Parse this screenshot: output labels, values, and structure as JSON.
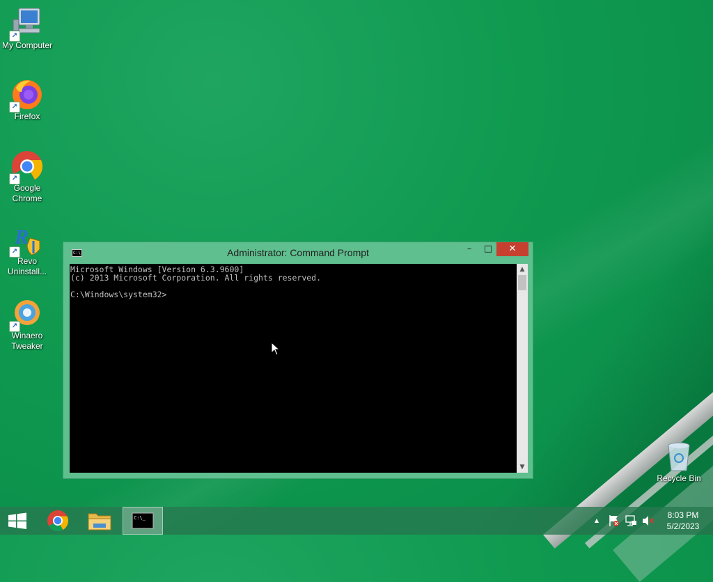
{
  "desktop": {
    "icons": [
      {
        "label": "My Computer",
        "icon": "computer-icon"
      },
      {
        "label": "Firefox",
        "icon": "firefox-icon"
      },
      {
        "label": "Google Chrome",
        "icon": "chrome-icon"
      },
      {
        "label": "Revo Uninstall...",
        "icon": "revo-uninstaller-icon"
      },
      {
        "label": "Winaero Tweaker",
        "icon": "winaero-tweaker-icon"
      },
      {
        "label": "Recycle Bin",
        "icon": "recycle-bin-icon"
      }
    ]
  },
  "cmd_window": {
    "title": "Administrator:  Command Prompt",
    "minimize_label": "–",
    "maximize_label": "□",
    "close_label": "✕",
    "console_lines": [
      "Microsoft Windows [Version 6.3.9600]",
      "(c) 2013 Microsoft Corporation. All rights reserved.",
      "",
      "C:\\Windows\\system32>"
    ]
  },
  "taskbar": {
    "start": "windows-logo-icon",
    "pinned": [
      "chrome-icon",
      "file-explorer-icon",
      "command-prompt-icon"
    ],
    "tray": {
      "show_hidden": "▲",
      "icons": [
        "action-center-flag-icon",
        "network-icon",
        "volume-muted-icon"
      ]
    },
    "clock": {
      "time": "8:03 PM",
      "date": "5/2/2023"
    }
  },
  "colors": {
    "desktop_bg": "#0f9a50",
    "window_frame": "#5fbf8e",
    "close_button": "#c7402f",
    "console_bg": "#000000",
    "console_text": "#c0c0c0"
  }
}
